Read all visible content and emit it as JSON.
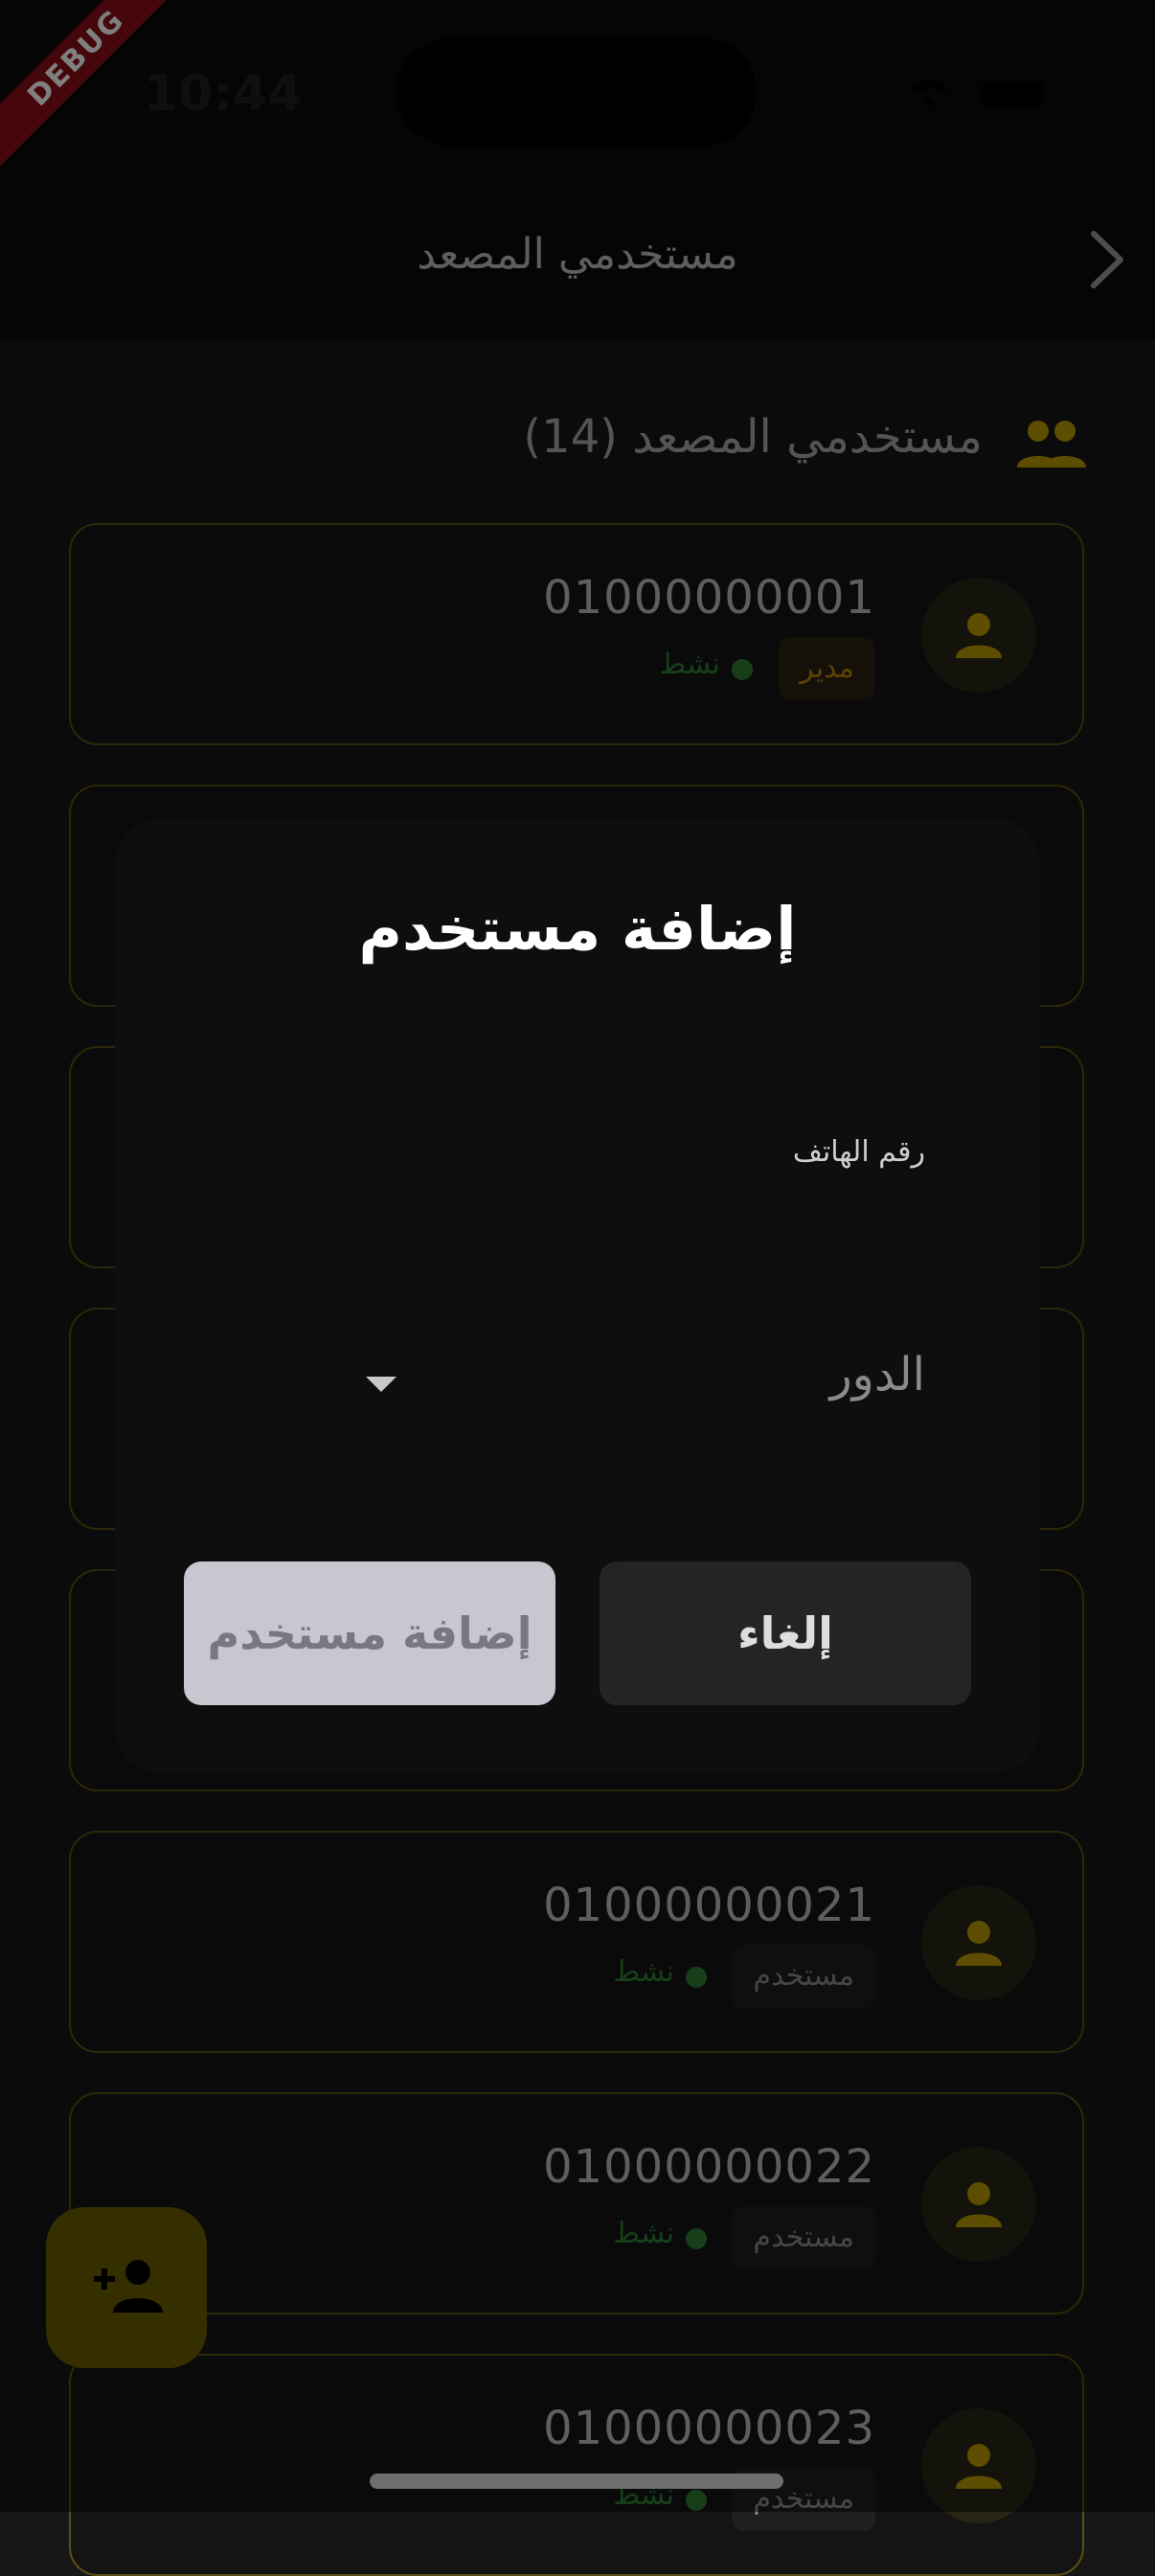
{
  "status_bar": {
    "time": "10:44"
  },
  "debug_banner": "DEBUG",
  "app_bar": {
    "title": "مستخدمي المصعد",
    "back_icon": "chevron-right-icon"
  },
  "section": {
    "title": "مستخدمي المصعد (14)",
    "icon": "group-icon"
  },
  "users": [
    {
      "phone": "01000000001",
      "role": "مدير",
      "status": "نشط"
    },
    {
      "phone": "01000000021",
      "role": "مستخدم",
      "status": "نشط"
    },
    {
      "phone": "01000000022",
      "role": "مستخدم",
      "status": "نشط"
    },
    {
      "phone": "01000000023",
      "role": "مستخدم",
      "status": "نشط"
    }
  ],
  "dialog": {
    "title": "إضافة مستخدم",
    "phone_label": "رقم الهاتف",
    "role_hint": "الدور",
    "add_button": "إضافة مستخدم",
    "cancel_button": "إلغاء"
  },
  "fab_icon": "person-add-icon",
  "colors": {
    "accent": "#c9ab00",
    "active": "#2e7d32",
    "background": "#171717"
  }
}
